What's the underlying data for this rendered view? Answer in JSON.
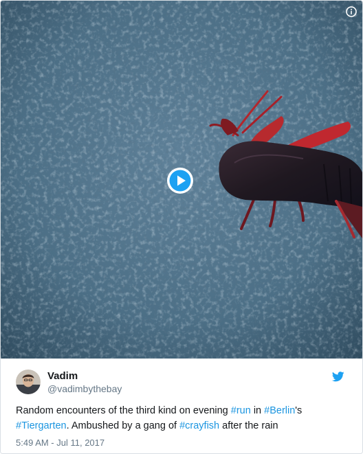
{
  "media": {
    "type": "video",
    "info_icon": "info-icon",
    "play_icon": "play-icon",
    "accent_color": "#1da1f2"
  },
  "tweet": {
    "author": {
      "display_name": "Vadim",
      "handle": "@vadimbythebay"
    },
    "brand_icon": "twitter-bird-icon",
    "brand_color": "#1da1f2",
    "text": {
      "line1": {
        "t1": "Random encounters of the third kind on evening ",
        "tag_run": "#run",
        "t2": " in ",
        "tag_berlin": "#Berlin",
        "t3": "'s"
      },
      "line2": {
        "tag_tiergarten": "#Tiergarten",
        "t1": ". Ambushed by a gang of ",
        "tag_crayfish": "#crayfish",
        "t2": " after the rain"
      }
    },
    "hashtag_color": "#1b95e0",
    "timestamp": "5:49 AM - Jul 11, 2017"
  }
}
